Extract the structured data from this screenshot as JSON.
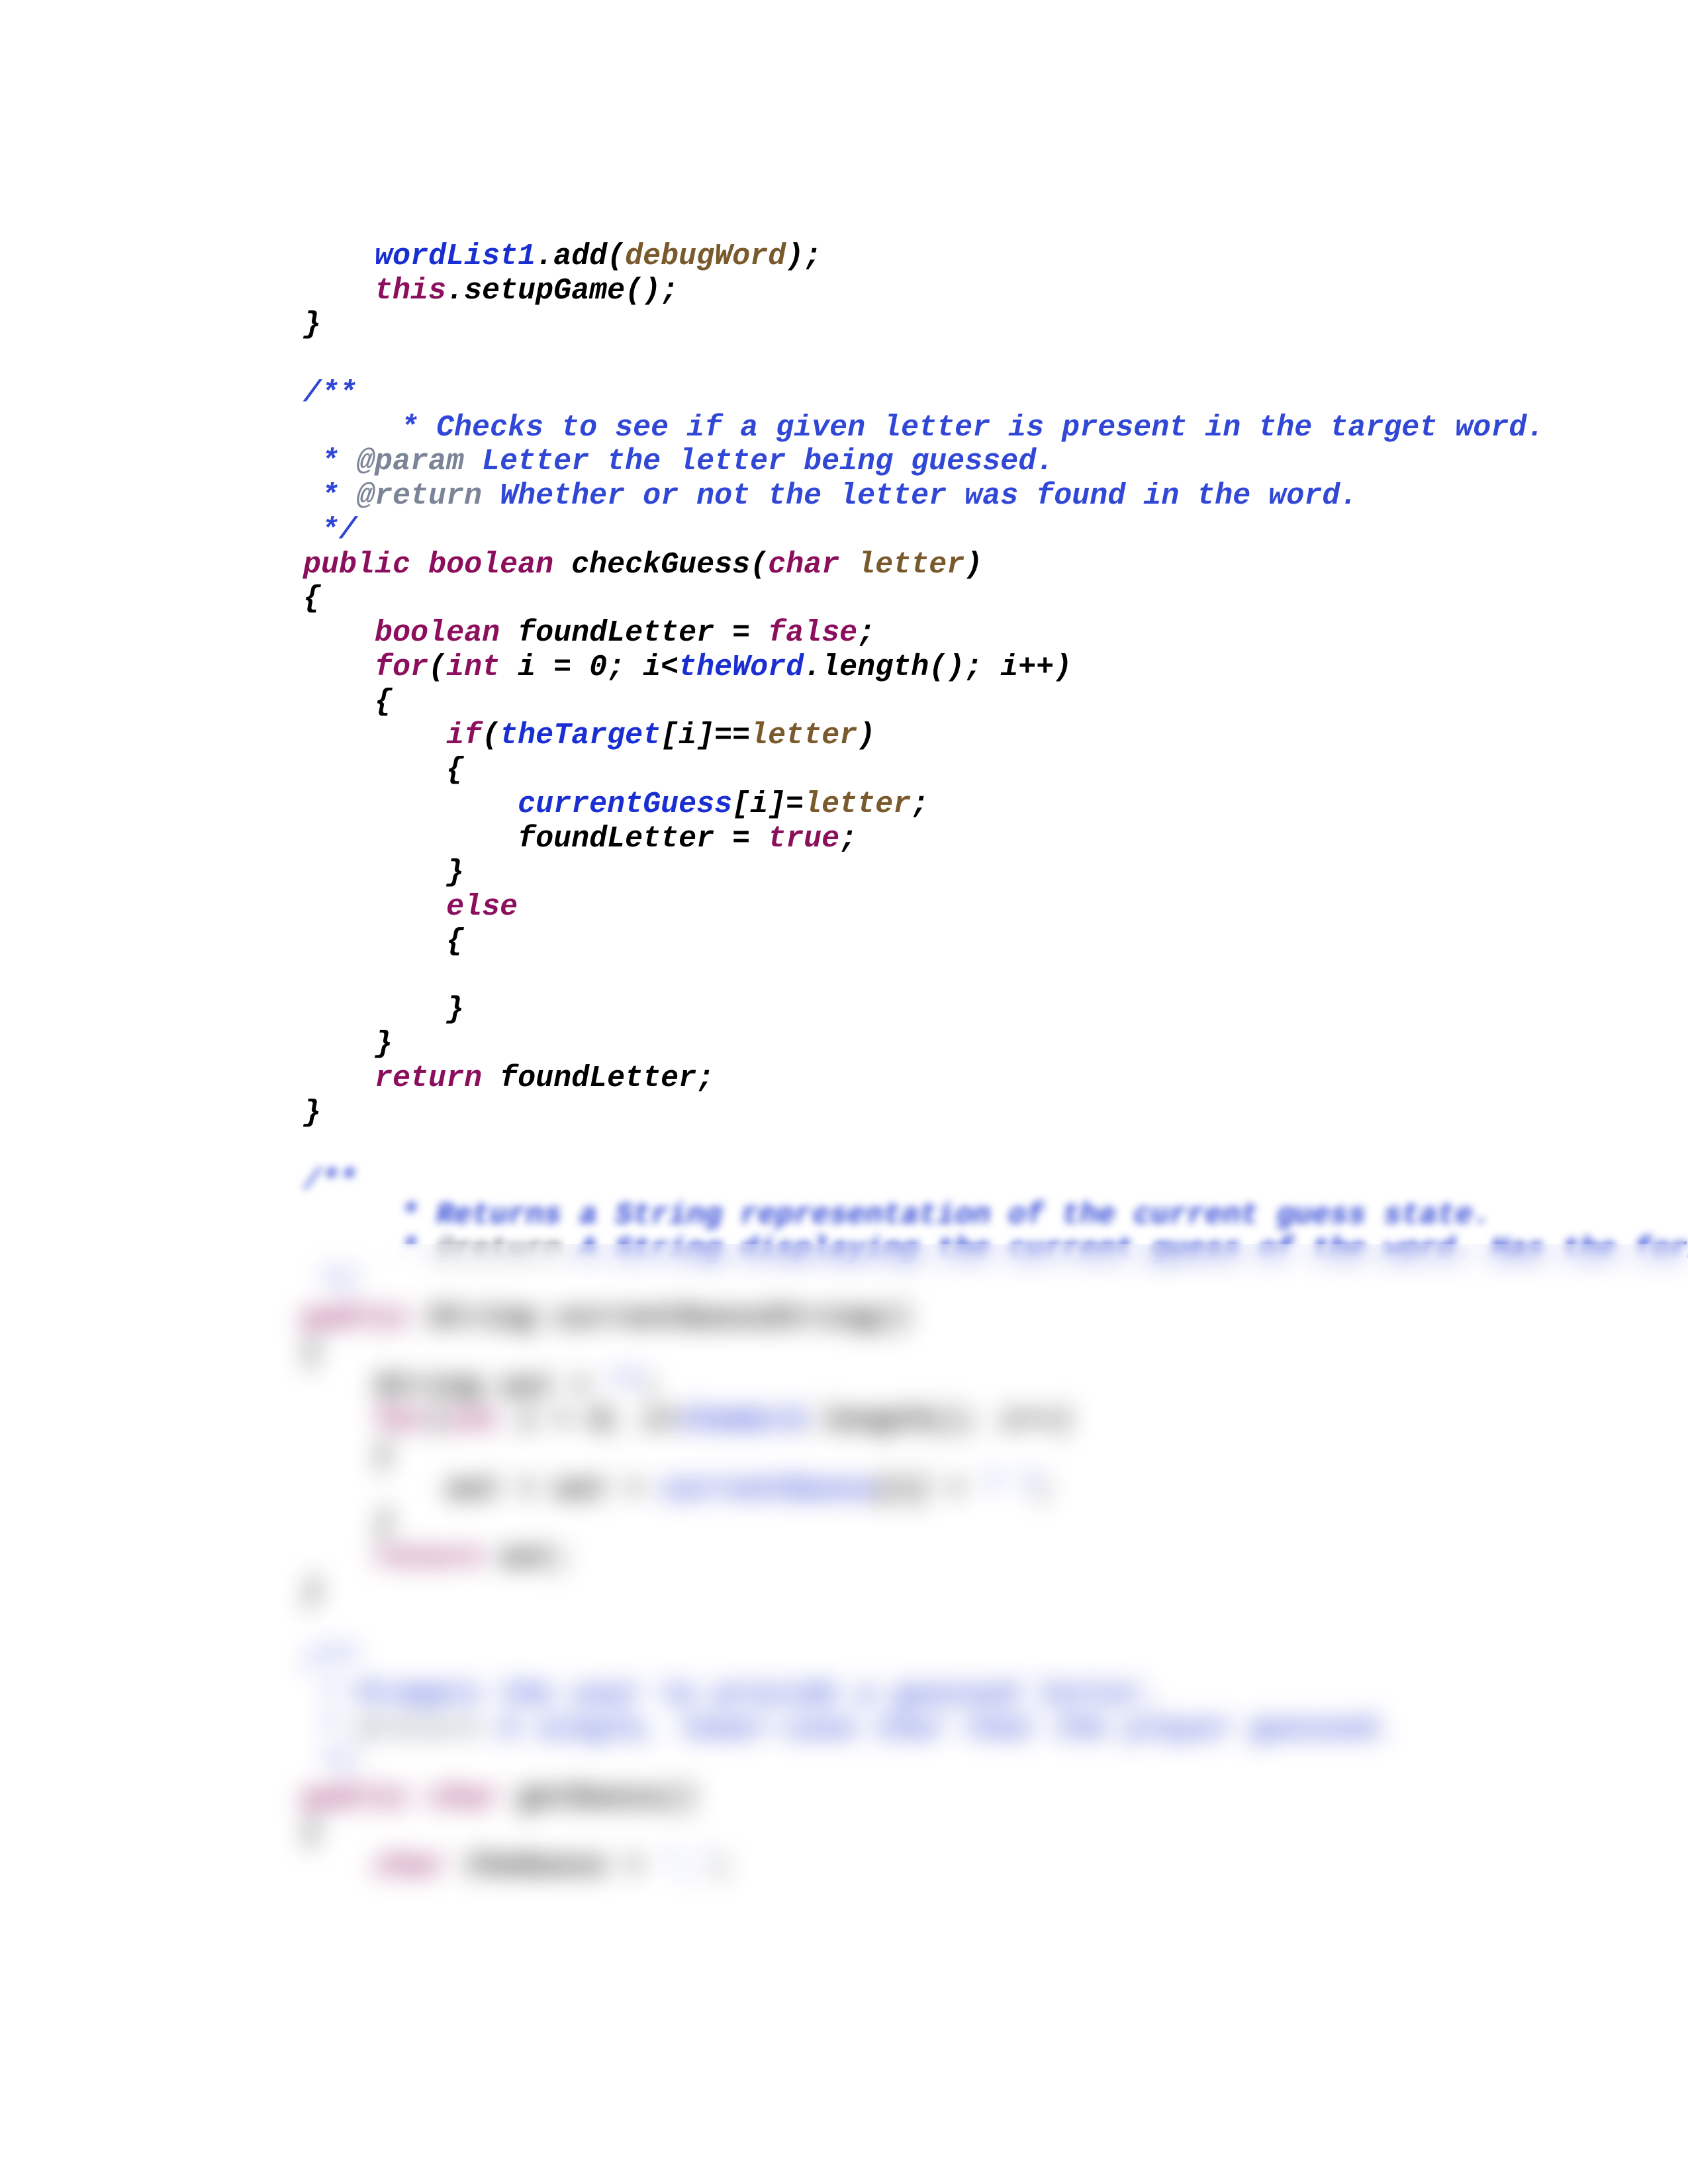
{
  "code": {
    "l01a": "        ",
    "l01b": "wordList1",
    "l01c": ".",
    "l01d": "add",
    "l01e": "(",
    "l01f": "debugWord",
    "l01g": ");",
    "l02a": "        ",
    "l02b": "this",
    "l02c": ".setupGame();",
    "l03": "    }",
    "l04": "",
    "l05": "    /**",
    "l06": "     * Checks to see if a given letter is present in the target word.",
    "l07a": "     * ",
    "l07b": "@param",
    "l07c": " Letter the letter being guessed.",
    "l08a": "     * ",
    "l08b": "@return",
    "l08c": " Whether or not the letter was found in the word.",
    "l09": "     */",
    "l10a": "    ",
    "l10b": "public",
    "l10c": " ",
    "l10d": "boolean",
    "l10e": " ",
    "l10f": "checkGuess",
    "l10g": "(",
    "l10h": "char",
    "l10i": " ",
    "l10j": "letter",
    "l10k": ")",
    "l11": "    {",
    "l12a": "        ",
    "l12b": "boolean",
    "l12c": " foundLetter = ",
    "l12d": "false",
    "l12e": ";",
    "l13a": "        ",
    "l13b": "for",
    "l13c": "(",
    "l13d": "int",
    "l13e": " i = 0; i<",
    "l13f": "theWord",
    "l13g": ".length(); i++)",
    "l14": "        {",
    "l15a": "            ",
    "l15b": "if",
    "l15c": "(",
    "l15d": "theTarget",
    "l15e": "[i]==",
    "l15f": "letter",
    "l15g": ")",
    "l16": "            {",
    "l17a": "                ",
    "l17b": "currentGuess",
    "l17c": "[i]=",
    "l17d": "letter",
    "l17e": ";",
    "l18a": "                foundLetter = ",
    "l18b": "true",
    "l18c": ";",
    "l19": "            }",
    "l20a": "            ",
    "l20b": "else",
    "l21": "            {",
    "l22": "",
    "l23": "            }",
    "l24": "        }",
    "l25a": "        ",
    "l25b": "return",
    "l25c": " foundLetter;",
    "l26": "    }",
    "l27": "",
    "l28": "    /**",
    "l29": "     * Returns a String representation of the current guess state.",
    "l30a": "     * ",
    "l30b": "@return",
    "l30c": " A String displaying the current guess of the word. Has the form \"g _ e _ _ \".",
    "l31": "     */",
    "l32a": "    ",
    "l32b": "public",
    "l32c": " String currentGuessString()",
    "l33": "    {",
    "l34a": "        String out = ",
    "l34b": "\"\"",
    "l34c": ";",
    "l35a": "        ",
    "l35b": "for",
    "l35c": "(",
    "l35d": "int",
    "l35e": " i = 0; i<",
    "l35f": "theWord",
    "l35g": ".length(); i++)",
    "l36": "        {",
    "l37a": "            out = out + ",
    "l37b": "currentGuess",
    "l37c": "[i] + ",
    "l37d": "\" \"",
    "l37e": ";",
    "l38": "        }",
    "l39a": "        ",
    "l39b": "return",
    "l39c": " out;",
    "l40": "    }",
    "l41": "",
    "l42": "    /**",
    "l43": "     * Prompts the user to provide a guessed letter.",
    "l44a": "     * ",
    "l44b": "@return",
    "l44c": " A single, lower-case char that the player guessed.",
    "l45": "     */",
    "l46a": "    ",
    "l46b": "public",
    "l46c": " ",
    "l46d": "char",
    "l46e": " getGuess()",
    "l47": "    {",
    "l48a": "        ",
    "l48b": "char",
    "l48c": " theGuess = ",
    "l48d": "'_'",
    "l48e": ";"
  }
}
